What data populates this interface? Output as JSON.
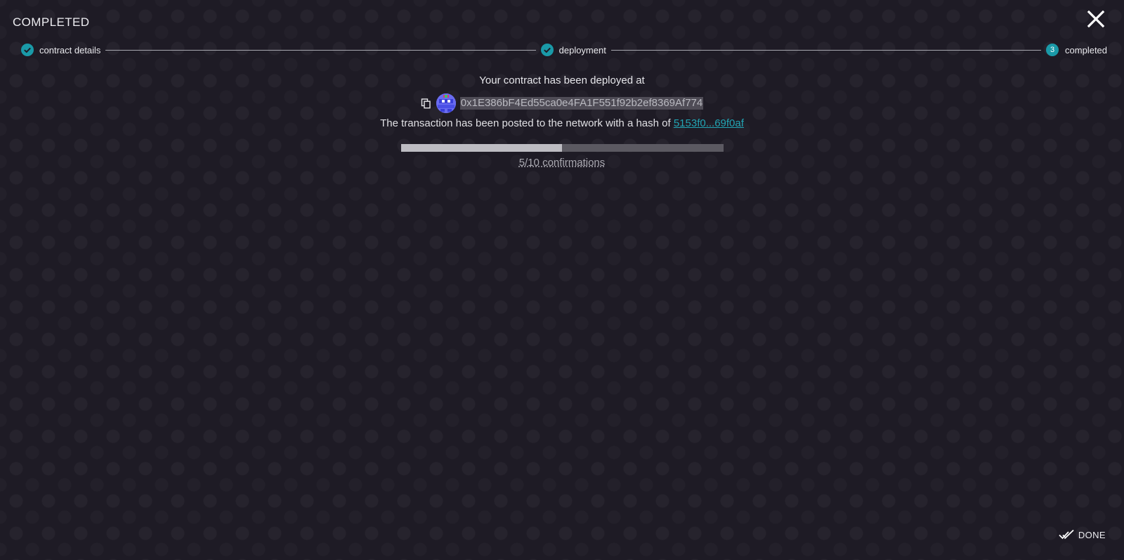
{
  "header": {
    "title": "COMPLETED",
    "close_icon": "close-icon"
  },
  "stepper": {
    "steps": [
      {
        "label": "contract details",
        "state": "done",
        "icon": "check-circle-icon"
      },
      {
        "label": "deployment",
        "state": "done",
        "icon": "check-circle-icon"
      },
      {
        "label": "completed",
        "state": "active",
        "number": "3"
      }
    ]
  },
  "main": {
    "deployed_message": "Your contract has been deployed at",
    "address": "0x1E386bF4Ed55ca0e4FA1F551f92b2ef8369Af774",
    "tx_prefix": "The transaction has been posted to the network with a hash of",
    "tx_hash_short": "5153f0...69f0af",
    "confirmations": {
      "current": 5,
      "total": 10,
      "label": "5/10 confirmations"
    }
  },
  "footer": {
    "done_label": "DONE",
    "done_icon": "double-check-icon"
  },
  "colors": {
    "background": "#1e1b25",
    "accent": "#1a9aa8",
    "link": "#22a5b4",
    "progress_track": "#5b5961",
    "progress_fill": "#bdbcc2"
  }
}
